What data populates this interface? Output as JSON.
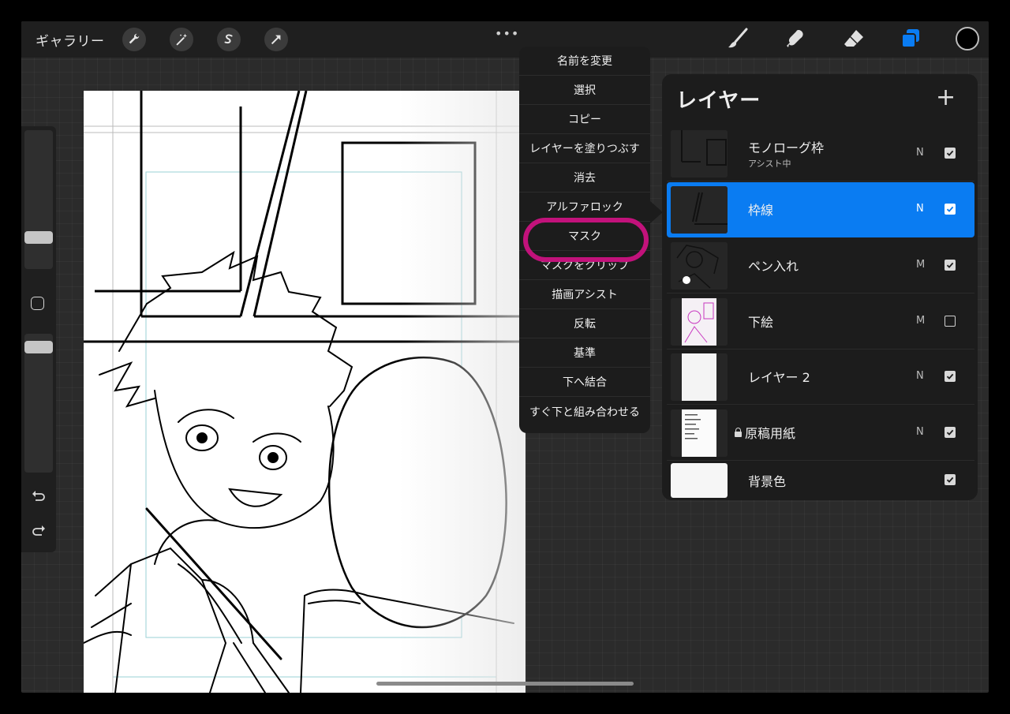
{
  "toolbar": {
    "gallery_label": "ギャラリー",
    "more_label": "•••",
    "tools_left": [
      "wrench-icon",
      "magic-wand-icon",
      "selection-icon",
      "transform-arrow-icon"
    ],
    "tools_right": [
      "brush-icon",
      "smudge-icon",
      "eraser-icon",
      "layers-icon"
    ],
    "active_color": "#000000",
    "accent": "#0a7cf2"
  },
  "sidebar": {
    "brush_size_level": 0.81,
    "opacity_level": 0.19,
    "icons": [
      "modify-square-icon",
      "undo-icon",
      "redo-icon"
    ]
  },
  "context_menu": {
    "items": [
      "名前を変更",
      "選択",
      "コピー",
      "レイヤーを塗りつぶす",
      "消去",
      "アルファロック",
      "マスク",
      "マスクをクリップ",
      "描画アシスト",
      "反転",
      "基準",
      "下へ結合",
      "すぐ下と組み合わせる"
    ],
    "highlighted_item": "マスク",
    "highlight_color": "#c2127b"
  },
  "layers": {
    "title": "レイヤー",
    "add_label": "+",
    "items": [
      {
        "name": "モノローグ枠",
        "sub": "アシスト中",
        "blend": "N",
        "visible": true,
        "active": false,
        "locked": false
      },
      {
        "name": "枠線",
        "sub": "",
        "blend": "N",
        "visible": true,
        "active": true,
        "locked": false
      },
      {
        "name": "ペン入れ",
        "sub": "",
        "blend": "M",
        "visible": true,
        "active": false,
        "locked": false
      },
      {
        "name": "下絵",
        "sub": "",
        "blend": "M",
        "visible": false,
        "active": false,
        "locked": false
      },
      {
        "name": "レイヤー 2",
        "sub": "",
        "blend": "N",
        "visible": true,
        "active": false,
        "locked": false
      },
      {
        "name": "原稿用紙",
        "sub": "",
        "blend": "N",
        "visible": true,
        "active": false,
        "locked": true
      },
      {
        "name": "背景色",
        "sub": "",
        "blend": "",
        "visible": true,
        "active": false,
        "locked": false
      }
    ]
  }
}
